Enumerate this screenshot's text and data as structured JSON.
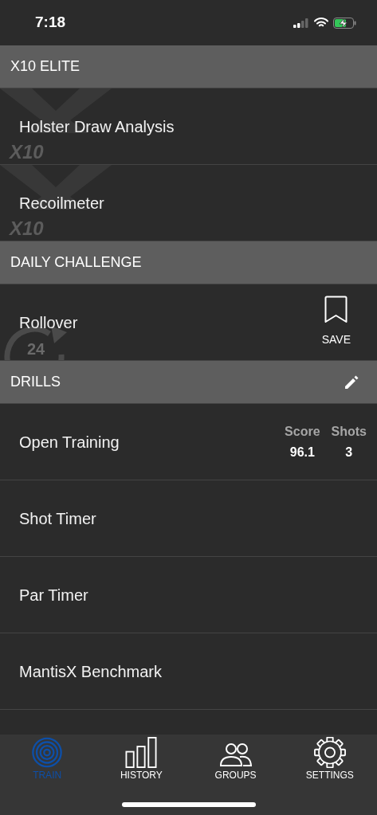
{
  "status_bar": {
    "time": "7:18"
  },
  "sections": [
    {
      "title": "X10 ELITE",
      "editable": false,
      "items": [
        {
          "kind": "elite",
          "label": "Holster Draw Analysis",
          "badge": "X10"
        },
        {
          "kind": "elite",
          "label": "Recoilmeter",
          "badge": "X10"
        }
      ]
    },
    {
      "title": "DAILY CHALLENGE",
      "editable": false,
      "items": [
        {
          "kind": "daily",
          "label": "Rollover",
          "badge": "24",
          "action": "SAVE"
        }
      ]
    },
    {
      "title": "DRILLS",
      "editable": true,
      "items": [
        {
          "kind": "drill",
          "label": "Open Training",
          "stats": [
            {
              "label": "Score",
              "value": "96.1"
            },
            {
              "label": "Shots",
              "value": "3"
            }
          ]
        },
        {
          "kind": "drill",
          "label": "Shot Timer"
        },
        {
          "kind": "drill",
          "label": "Par Timer"
        },
        {
          "kind": "drill",
          "label": "MantisX Benchmark"
        }
      ]
    }
  ],
  "tab_bar": [
    {
      "kind": "train",
      "label": "TRAIN",
      "selected": true
    },
    {
      "kind": "history",
      "label": "HISTORY",
      "selected": false
    },
    {
      "kind": "groups",
      "label": "GROUPS",
      "selected": false
    },
    {
      "kind": "settings",
      "label": "SETTINGS",
      "selected": false
    }
  ]
}
